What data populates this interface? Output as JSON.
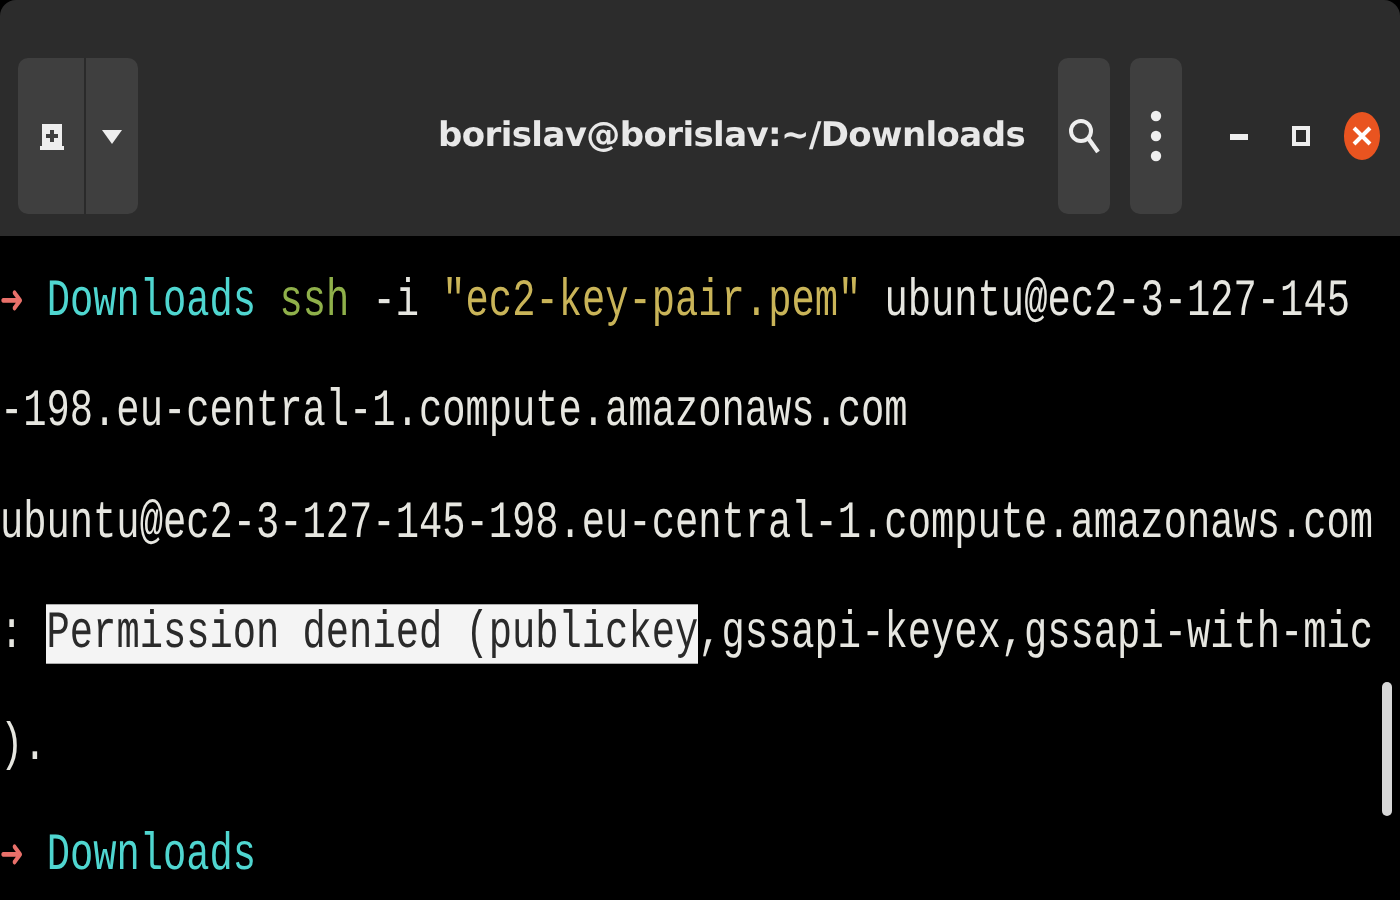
{
  "window": {
    "title": "borislav@borislav:~/Downloads"
  },
  "terminal": {
    "lines": [
      [
        {
          "kind": "arrow",
          "text": "➜"
        },
        {
          "kind": "dir",
          "text": " Downloads"
        },
        {
          "kind": "command",
          "text": " ssh"
        },
        {
          "kind": "plain",
          "text": " -i "
        },
        {
          "kind": "string",
          "text": "\"ec2-key-pair.pem\""
        },
        {
          "kind": "plain",
          "text": " ubuntu@ec2-3-127-145"
        }
      ],
      [
        {
          "kind": "plain",
          "text": "-198.eu-central-1.compute.amazonaws.com"
        }
      ],
      [
        {
          "kind": "plain",
          "text": "ubuntu@ec2-3-127-145-198.eu-central-1.compute.amazonaws.com"
        }
      ],
      [
        {
          "kind": "plain",
          "text": ": "
        },
        {
          "kind": "selected",
          "text": "Permission denied (publickey"
        },
        {
          "kind": "plain",
          "text": ",gssapi-keyex,gssapi-with-mic"
        }
      ],
      [
        {
          "kind": "plain",
          "text": ")."
        }
      ],
      [
        {
          "kind": "arrow",
          "text": "➜"
        },
        {
          "kind": "dir",
          "text": " Downloads"
        }
      ]
    ]
  }
}
